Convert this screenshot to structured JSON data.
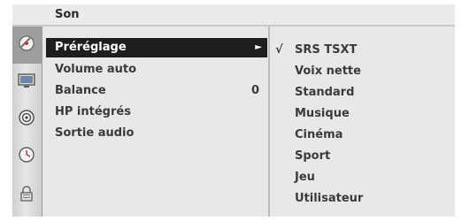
{
  "menu": {
    "title": "Son",
    "icons": [
      {
        "name": "satellite-dish-icon",
        "selected": true
      },
      {
        "name": "tv-screen-icon",
        "selected": false
      },
      {
        "name": "speaker-icon",
        "selected": false
      },
      {
        "name": "clock-icon",
        "selected": false
      },
      {
        "name": "lock-icon",
        "selected": false
      }
    ],
    "items": [
      {
        "label": "Préréglage",
        "value": "",
        "selected": true,
        "arrow": "►"
      },
      {
        "label": "Volume auto",
        "value": ""
      },
      {
        "label": "Balance",
        "value": "0"
      },
      {
        "label": "HP intégrés",
        "value": ""
      },
      {
        "label": "Sortie audio",
        "value": ""
      }
    ],
    "submenu": {
      "check_mark": "√",
      "options": [
        {
          "label": "SRS TSXT",
          "checked": true
        },
        {
          "label": "Voix nette",
          "checked": false
        },
        {
          "label": "Standard",
          "checked": false
        },
        {
          "label": "Musique",
          "checked": false
        },
        {
          "label": "Cinéma",
          "checked": false
        },
        {
          "label": "Sport",
          "checked": false
        },
        {
          "label": "Jeu",
          "checked": false
        },
        {
          "label": "Utilisateur",
          "checked": false
        }
      ]
    }
  },
  "colors": {
    "highlight_bg": "#1e1e1e",
    "panel_bg": "#e8e8e8",
    "text": "#3a3a3a"
  }
}
